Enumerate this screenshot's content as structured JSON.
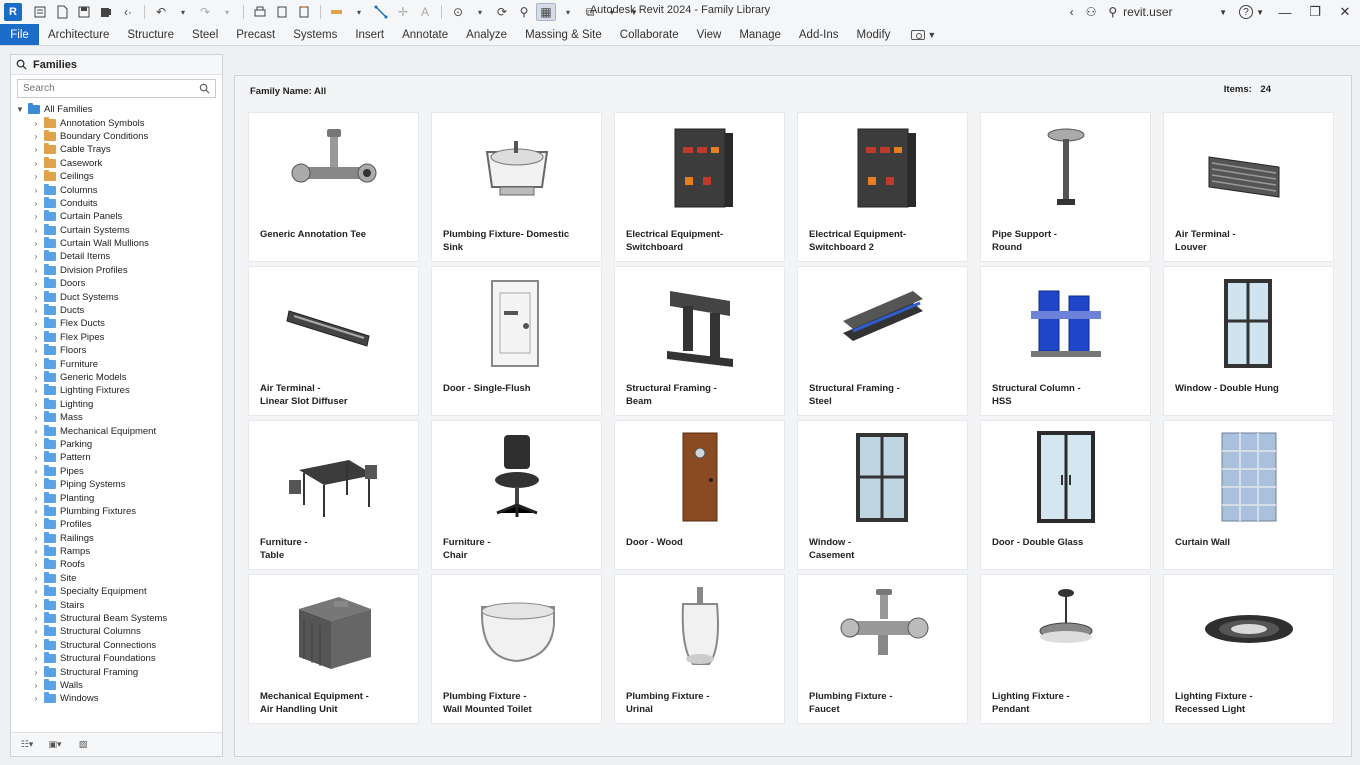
{
  "app": {
    "title": "Autodesk Revit 2024 - Family Library",
    "logo": "R",
    "user": "revit.user",
    "help": "?"
  },
  "ribbon": {
    "tabs": [
      "File",
      "Architecture",
      "Structure",
      "Steel",
      "Precast",
      "Systems",
      "Insert",
      "Annotate",
      "Analyze",
      "Massing & Site",
      "Collaborate",
      "View",
      "Manage",
      "Add-Ins",
      "Modify"
    ]
  },
  "families_panel": {
    "header": "Families",
    "search_placeholder": "Search",
    "root": "All Families",
    "items": [
      {
        "label": "Annotation Symbols",
        "color": "orange"
      },
      {
        "label": "Boundary Conditions",
        "color": "orange"
      },
      {
        "label": "Cable Trays",
        "color": "orange"
      },
      {
        "label": "Casework",
        "color": "orange"
      },
      {
        "label": "Ceilings",
        "color": "orange"
      },
      {
        "label": "Columns",
        "color": "blue"
      },
      {
        "label": "Conduits",
        "color": "blue"
      },
      {
        "label": "Curtain Panels",
        "color": "blue"
      },
      {
        "label": "Curtain Systems",
        "color": "blue"
      },
      {
        "label": "Curtain Wall Mullions",
        "color": "blue"
      },
      {
        "label": "Detail Items",
        "color": "blue"
      },
      {
        "label": "Division Profiles",
        "color": "blue"
      },
      {
        "label": "Doors",
        "color": "blue"
      },
      {
        "label": "Duct Systems",
        "color": "blue"
      },
      {
        "label": "Ducts",
        "color": "blue"
      },
      {
        "label": "Flex Ducts",
        "color": "blue"
      },
      {
        "label": "Flex Pipes",
        "color": "blue"
      },
      {
        "label": "Floors",
        "color": "blue"
      },
      {
        "label": "Furniture",
        "color": "blue"
      },
      {
        "label": "Generic Models",
        "color": "blue"
      },
      {
        "label": "Lighting Fixtures",
        "color": "blue"
      },
      {
        "label": "Lighting",
        "color": "blue"
      },
      {
        "label": "Mass",
        "color": "blue"
      },
      {
        "label": "Mechanical Equipment",
        "color": "blue"
      },
      {
        "label": "Parking",
        "color": "blue"
      },
      {
        "label": "Pattern",
        "color": "blue"
      },
      {
        "label": "Pipes",
        "color": "blue"
      },
      {
        "label": "Piping Systems",
        "color": "blue"
      },
      {
        "label": "Planting",
        "color": "blue"
      },
      {
        "label": "Plumbing Fixtures",
        "color": "blue"
      },
      {
        "label": "Profiles",
        "color": "blue"
      },
      {
        "label": "Railings",
        "color": "blue"
      },
      {
        "label": "Ramps",
        "color": "blue"
      },
      {
        "label": "Roofs",
        "color": "blue"
      },
      {
        "label": "Site",
        "color": "blue"
      },
      {
        "label": "Specialty Equipment",
        "color": "blue"
      },
      {
        "label": "Stairs",
        "color": "blue"
      },
      {
        "label": "Structural Beam Systems",
        "color": "blue"
      },
      {
        "label": "Structural Columns",
        "color": "blue"
      },
      {
        "label": "Structural Connections",
        "color": "blue"
      },
      {
        "label": "Structural Foundations",
        "color": "blue"
      },
      {
        "label": "Structural Framing",
        "color": "blue"
      },
      {
        "label": "Walls",
        "color": "blue"
      },
      {
        "label": "Windows",
        "color": "blue"
      }
    ]
  },
  "main": {
    "family_name_label": "Family Name: All",
    "items_label": "Items:",
    "items_count": "24",
    "cards": [
      {
        "label": "Generic Annotation Tee",
        "icon": "pipe-tee"
      },
      {
        "label": "Plumbing Fixture- Domestic\nSink",
        "icon": "sink"
      },
      {
        "label": "Electrical Equipment-\nSwitchboard",
        "icon": "switchboard"
      },
      {
        "label": "Electrical Equipment-\nSwitchboard 2",
        "icon": "switchboard"
      },
      {
        "label": "Pipe Support -\nRound",
        "icon": "pipe-support"
      },
      {
        "label": "Air Terminal -\nLouver",
        "icon": "louver"
      },
      {
        "label": "Air Terminal -\nLinear Slot Diffuser",
        "icon": "slot-diffuser"
      },
      {
        "label": "Door - Single-Flush",
        "icon": "door-frame"
      },
      {
        "label": "Structural Framing -\nBeam",
        "icon": "beam"
      },
      {
        "label": "Structural Framing -\nSteel",
        "icon": "steel-beam"
      },
      {
        "label": "Structural Column -\nHSS",
        "icon": "hss-column"
      },
      {
        "label": "Window - Double Hung",
        "icon": "window-double-hung"
      },
      {
        "label": "Furniture -\nTable",
        "icon": "table"
      },
      {
        "label": "Furniture -\nChair",
        "icon": "chair"
      },
      {
        "label": "Door - Wood",
        "icon": "door-wood"
      },
      {
        "label": "Window -\nCasement",
        "icon": "window-casement"
      },
      {
        "label": "Door - Double Glass",
        "icon": "door-glass"
      },
      {
        "label": "Curtain Wall",
        "icon": "curtain-wall"
      },
      {
        "label": "Mechanical Equipment -\nAir Handling Unit",
        "icon": "ahu"
      },
      {
        "label": "Plumbing Fixture -\nWall Mounted Toilet",
        "icon": "toilet"
      },
      {
        "label": "Plumbing Fixture -\nUrinal",
        "icon": "urinal"
      },
      {
        "label": "Plumbing Fixture -\nFaucet",
        "icon": "faucet"
      },
      {
        "label": "Lighting Fixture -\nPendant",
        "icon": "pendant"
      },
      {
        "label": "Lighting Fixture -\nRecessed Light",
        "icon": "recessed-light"
      }
    ]
  }
}
